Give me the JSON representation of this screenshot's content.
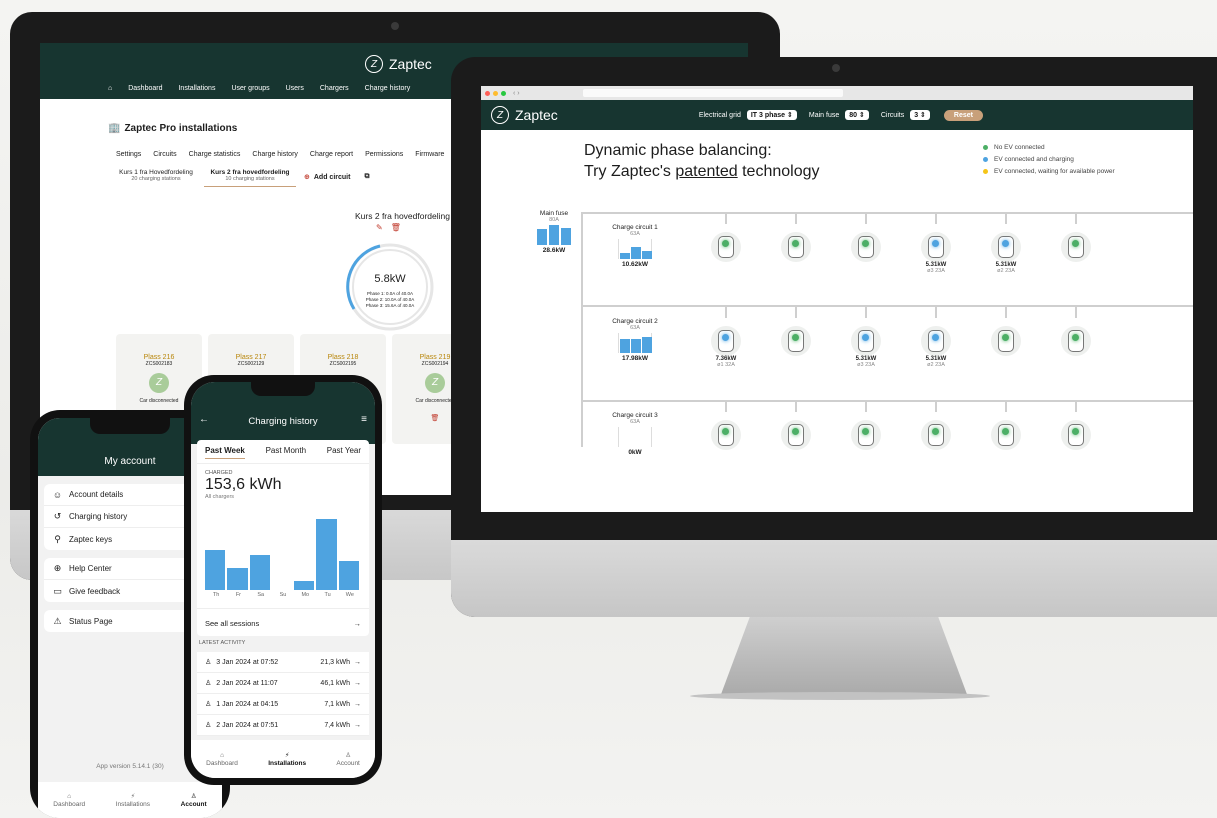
{
  "brand": {
    "name": "Zaptec",
    "logo_glyph": "Z",
    "primary_color": "#173530",
    "accent_blue": "#4ea3e0",
    "accent_green": "#4caf66",
    "accent_yellow": "#f5c518",
    "reset_color": "#c8a07a"
  },
  "back_monitor": {
    "nav": [
      "Dashboard",
      "Installations",
      "User groups",
      "Users",
      "Chargers",
      "Charge history"
    ],
    "page_title": "Zaptec Pro installations",
    "tabs": [
      "Settings",
      "Circuits",
      "Charge statistics",
      "Charge history",
      "Charge report",
      "Permissions",
      "Firmware"
    ],
    "circuits": [
      {
        "name": "Kurs 1 fra Hovedfordeling",
        "sub": "20 charging stations"
      },
      {
        "name": "Kurs 2 fra hovedfordeling",
        "sub": "10 charging stations"
      }
    ],
    "add_circuit": "Add circuit",
    "circuit_title": "Kurs 2 fra hovedfordeling",
    "gauge": {
      "value": "5.8kW",
      "phases": [
        "Phase 1: 0.0A of 40.0A",
        "Phase 2: 10.0A of 40.0A",
        "Phase 3: 15.6A of 40.0A"
      ]
    },
    "stations": [
      {
        "name": "Plass 216",
        "id": "ZCS002183",
        "status": "Car disconnected"
      },
      {
        "name": "Plass 217",
        "id": "ZCS002129"
      },
      {
        "name": "Plass 218",
        "id": "ZCS002195"
      },
      {
        "name": "Plass 219",
        "id": "ZCS002194",
        "status": "Car disconnected"
      }
    ]
  },
  "front_monitor": {
    "controls": {
      "grid_label": "Electrical grid",
      "grid_value": "IT 3 phase",
      "fuse_label": "Main fuse",
      "fuse_value": "80",
      "circuits_label": "Circuits",
      "circuits_value": "3",
      "reset": "Reset"
    },
    "headline_1": "Dynamic phase balancing:",
    "headline_2_pre": "Try Zaptec's ",
    "headline_2_link": "patented",
    "headline_2_post": " technology",
    "legend": [
      "No EV connected",
      "EV connected and charging",
      "EV connected, waiting for available power"
    ],
    "main_fuse": {
      "label": "Main fuse",
      "amps": "80A",
      "power": "28.6kW"
    },
    "circuits": [
      {
        "name": "Charge circuit 1",
        "amps": "63A",
        "power": "10.62kW",
        "chargers": [
          {
            "state": "g"
          },
          {
            "state": "g"
          },
          {
            "state": "g"
          },
          {
            "state": "b",
            "power": "5.31kW",
            "sub": "ø3 23A"
          },
          {
            "state": "b",
            "power": "5.31kW",
            "sub": "ø2 23A"
          },
          {
            "state": "g"
          }
        ]
      },
      {
        "name": "Charge circuit 2",
        "amps": "63A",
        "power": "17.98kW",
        "chargers": [
          {
            "state": "b",
            "power": "7.36kW",
            "sub": "ø1 32A"
          },
          {
            "state": "g"
          },
          {
            "state": "b",
            "power": "5.31kW",
            "sub": "ø3 23A"
          },
          {
            "state": "b",
            "power": "5.31kW",
            "sub": "ø2 23A"
          },
          {
            "state": "g"
          },
          {
            "state": "g"
          }
        ]
      },
      {
        "name": "Charge circuit 3",
        "amps": "63A",
        "power": "0kW",
        "chargers": [
          {
            "state": "g"
          },
          {
            "state": "g"
          },
          {
            "state": "g"
          },
          {
            "state": "g"
          },
          {
            "state": "g"
          },
          {
            "state": "g"
          }
        ]
      }
    ]
  },
  "phone_account": {
    "title": "My account",
    "group1": [
      "Account details",
      "Charging history",
      "Zaptec keys"
    ],
    "group2": [
      "Help Center",
      "Give feedback"
    ],
    "group3": [
      "Status Page"
    ],
    "version": "App version 5.14.1 (30)",
    "tabs": [
      "Dashboard",
      "Installations",
      "Account"
    ]
  },
  "phone_history": {
    "title": "Charging history",
    "periods": [
      "Past Week",
      "Past Month",
      "Past Year"
    ],
    "charged_label": "CHARGED",
    "charged_value": "153,6 kWh",
    "charged_sub": "All chargers",
    "chart_data": {
      "type": "bar",
      "categories": [
        "Th",
        "Fr",
        "Sa",
        "Su",
        "Mo",
        "Tu",
        "We"
      ],
      "values": [
        35,
        19,
        31,
        0,
        8,
        62,
        25
      ],
      "ylim": [
        0,
        70
      ]
    },
    "see_all": "See all sessions",
    "latest_label": "LATEST ACTIVITY",
    "activity": [
      {
        "date": "3 Jan 2024 at 07:52",
        "value": "21,3 kWh"
      },
      {
        "date": "2 Jan 2024 at 11:07",
        "value": "46,1 kWh"
      },
      {
        "date": "1 Jan 2024 at 04:15",
        "value": "7,1 kWh"
      },
      {
        "date": "2 Jan 2024 at 07:51",
        "value": "7,4 kWh"
      }
    ],
    "tabs": [
      "Dashboard",
      "Installations",
      "Account"
    ]
  }
}
